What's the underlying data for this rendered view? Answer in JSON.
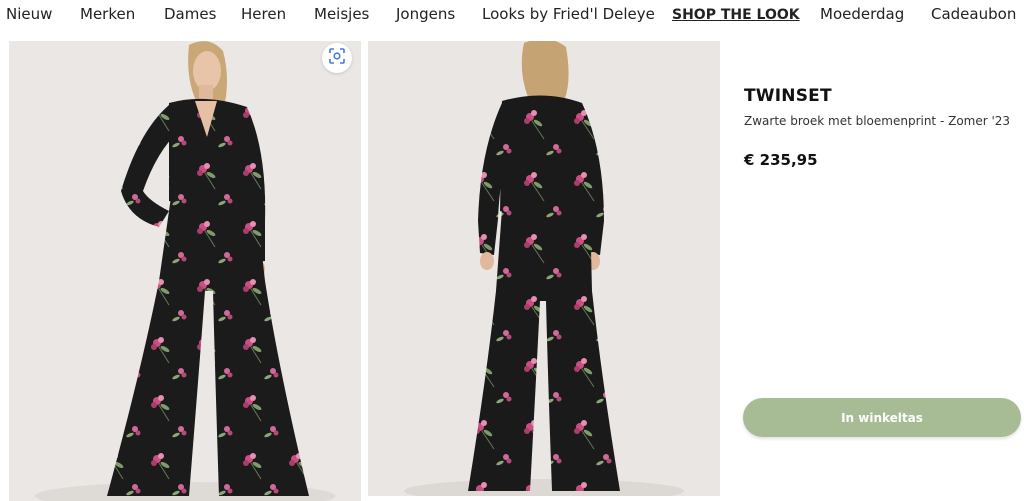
{
  "nav": {
    "items": [
      "Nieuw",
      "Merken",
      "Dames",
      "Heren",
      "Meisjes",
      "Jongens",
      "Looks by Fried'l Deleye",
      "SHOP THE LOOK",
      "Moederdag",
      "Cadeaubon"
    ]
  },
  "product": {
    "brand": "TWINSET",
    "description": "Zwarte broek met bloemenprint - Zomer '23",
    "price": "€ 235,95",
    "button_label": "In winkeltas"
  },
  "colors": {
    "button": "#a7bb95",
    "garment": "#1c1b1c",
    "flower": "#c94f82"
  },
  "icons": {
    "lens": "visual-search-icon"
  }
}
